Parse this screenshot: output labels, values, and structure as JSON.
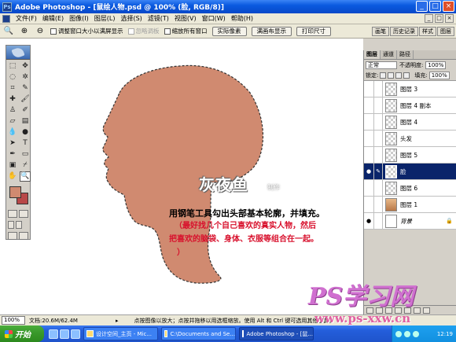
{
  "window": {
    "app_icon": "Ps",
    "title": "Adobe Photoshop - [鼠绘人物.psd @ 100% (脸, RGB/8)]",
    "controls": [
      "_",
      "□",
      "×"
    ]
  },
  "menu": {
    "items": [
      "文件(F)",
      "编辑(E)",
      "图像(I)",
      "图层(L)",
      "选择(S)",
      "滤镜(T)",
      "视图(V)",
      "窗口(W)",
      "帮助(H)"
    ],
    "doc_controls": [
      "_",
      "□",
      "×"
    ]
  },
  "options_bar": {
    "resize_windows_label": "调整窗口大小以满屏显示",
    "ignore_palettes_label": "忽略调板",
    "zoom_all_windows_label": "缩放所有窗口",
    "actual_pixels_label": "实际像素",
    "fit_on_screen_label": "满画布显示",
    "print_size_label": "打印尺寸",
    "wells": [
      "画笔",
      "历史记录",
      "样式",
      "图层"
    ]
  },
  "canvas": {
    "skin_color": "#d08a70",
    "brand_title": "灰夜鱼",
    "brand_sub": "制作",
    "instruction_line1": "用钢笔工具勾出头部基本轮廓，并填充。",
    "instruction_line2": "（最好找几个自己喜欢的真实人物，然后",
    "instruction_line3": "把喜欢的脑袋、身体、衣服等组合在一起。",
    "instruction_line4": "）"
  },
  "toolbox": {
    "foreground_color": "#d08a70",
    "background_color": "#b84848"
  },
  "layers_panel": {
    "tabs": [
      "图层",
      "通道",
      "路径"
    ],
    "blend_mode": "正常",
    "opacity_label": "不透明度:",
    "opacity_value": "100%",
    "lock_label": "锁定:",
    "fill_label": "填充:",
    "fill_value": "100%",
    "layers": [
      {
        "name": "图层 3",
        "visible": false,
        "active": false
      },
      {
        "name": "图层 4 副本",
        "visible": false,
        "active": false
      },
      {
        "name": "图层 4",
        "visible": false,
        "active": false
      },
      {
        "name": "头发",
        "visible": false,
        "active": false
      },
      {
        "name": "图层 5",
        "visible": false,
        "active": false
      },
      {
        "name": "脸",
        "visible": true,
        "active": true
      },
      {
        "name": "图层 6",
        "visible": false,
        "active": false
      },
      {
        "name": "图层 1",
        "visible": false,
        "active": false
      },
      {
        "name": "背景",
        "visible": true,
        "active": false
      }
    ]
  },
  "watermark": {
    "logo": "PS学习网",
    "url": "www.ps-xxw.cn"
  },
  "status_bar": {
    "zoom": "100%",
    "doc_info": "文档:20.6M/62.4M",
    "hint": "点按图像以放大；点按并拖移以用选框缩放。使用 Alt 和 Ctrl 键可选用其他工具。"
  },
  "taskbar": {
    "start_label": "开始",
    "tasks": [
      "设计空间_主页 - Mic...",
      "C:\\Documents and Se...",
      "Adobe Photoshop - [鼠..."
    ],
    "active_task_index": 2,
    "clock": "12:19"
  }
}
